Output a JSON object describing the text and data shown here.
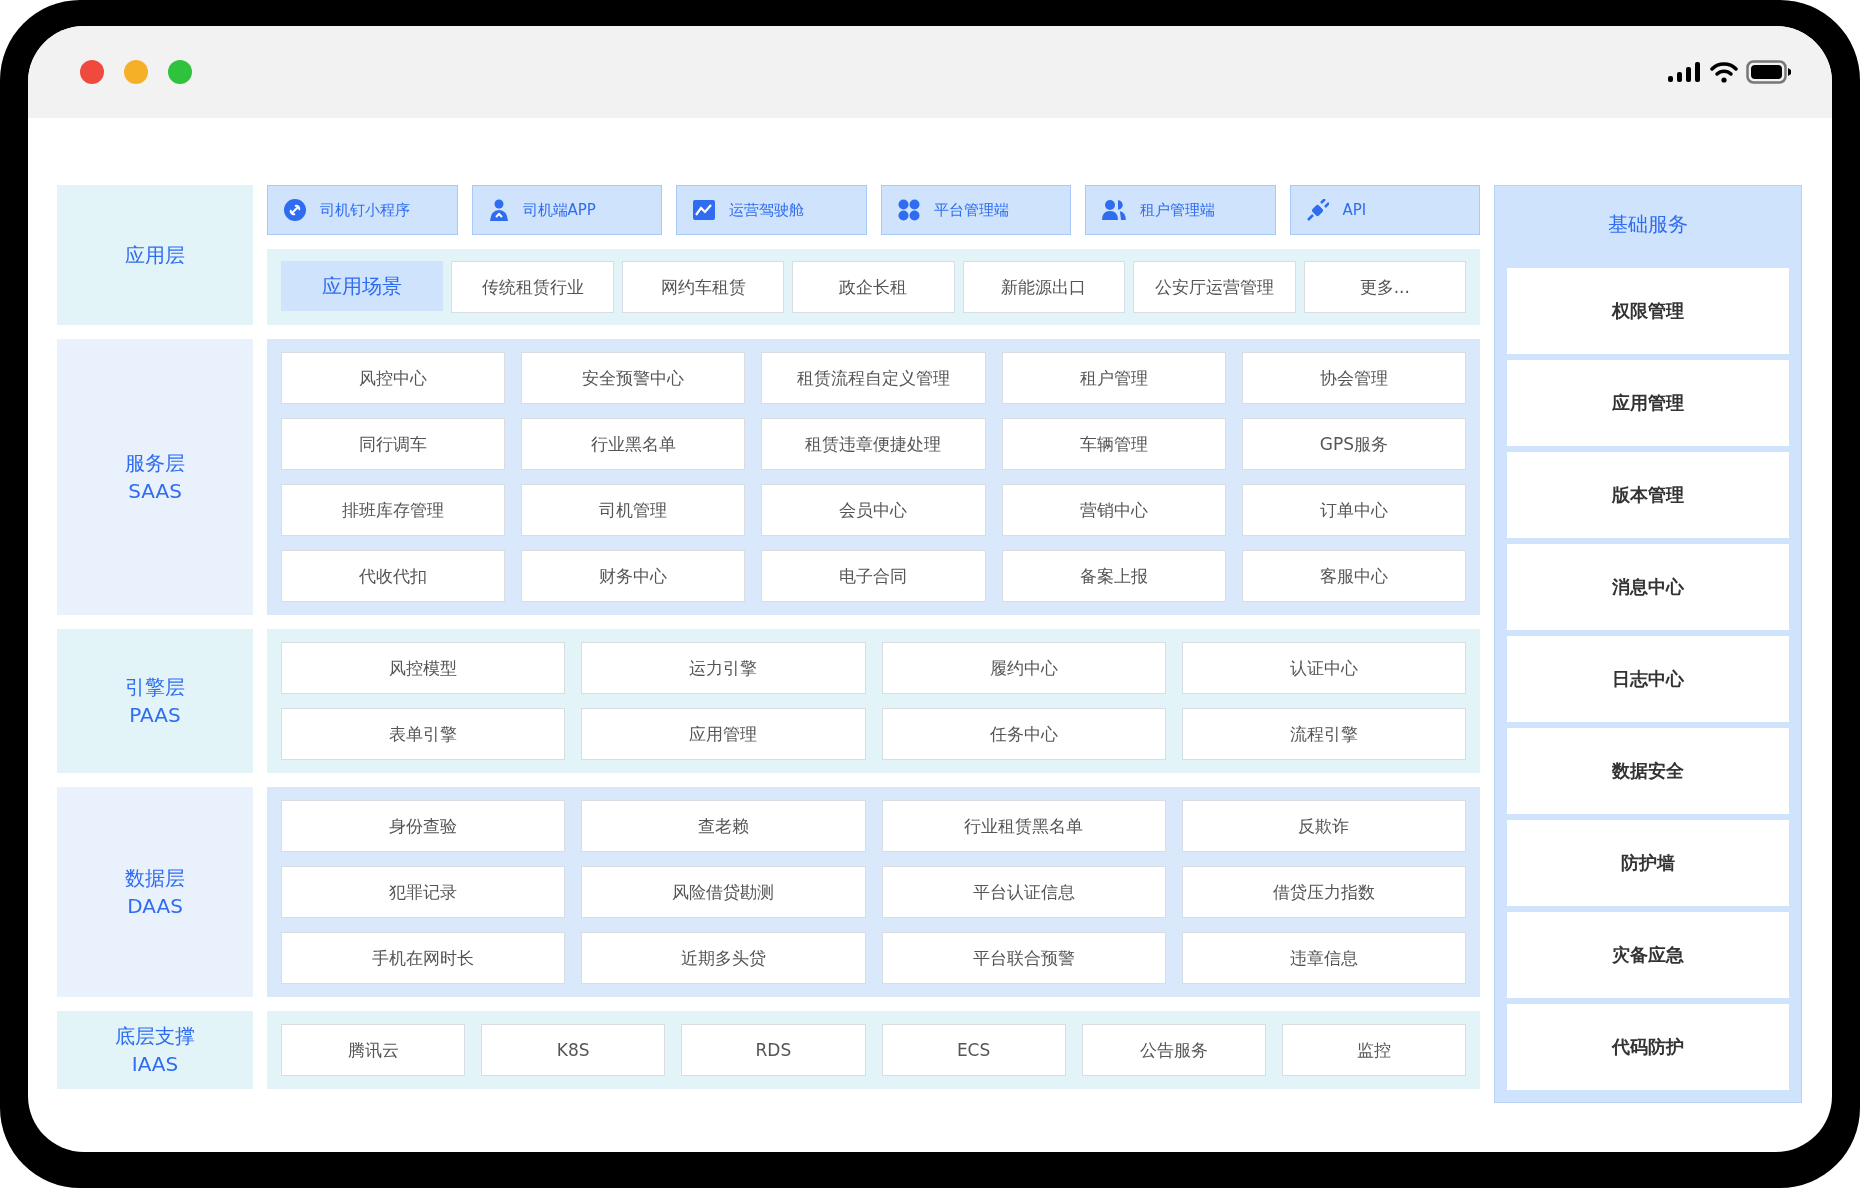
{
  "app_layer": {
    "title": "应用层",
    "entries": [
      "司机钉小程序",
      "司机端APP",
      "运营驾驶舱",
      "平台管理端",
      "租户管理端",
      "API"
    ],
    "scenario_heading": "应用场景",
    "scenarios": [
      "传统租赁行业",
      "网约车租赁",
      "政企长租",
      "新能源出口",
      "公安厅运营管理",
      "更多..."
    ]
  },
  "layers": [
    {
      "title": "服务层",
      "subtitle": "SAAS",
      "modules": [
        "风控中心",
        "安全预警中心",
        "租赁流程自定义管理",
        "租户管理",
        "协会管理",
        "同行调车",
        "行业黑名单",
        "租赁违章便捷处理",
        "车辆管理",
        "GPS服务",
        "排班库存管理",
        "司机管理",
        "会员中心",
        "营销中心",
        "订单中心",
        "代收代扣",
        "财务中心",
        "电子合同",
        "备案上报",
        "客服中心"
      ]
    },
    {
      "title": "引擎层",
      "subtitle": "PAAS",
      "modules": [
        "风控模型",
        "运力引擎",
        "履约中心",
        "认证中心",
        "表单引擎",
        "应用管理",
        "任务中心",
        "流程引擎"
      ]
    },
    {
      "title": "数据层",
      "subtitle": "DAAS",
      "modules": [
        "身份查验",
        "查老赖",
        "行业租赁黑名单",
        "反欺诈",
        "犯罪记录",
        "风险借贷勘测",
        "平台认证信息",
        "借贷压力指数",
        "手机在网时长",
        "近期多头贷",
        "平台联合预警",
        "违章信息"
      ]
    },
    {
      "title": "底层支撑",
      "subtitle": "IAAS",
      "modules": [
        "腾讯云",
        "K8S",
        "RDS",
        "ECS",
        "公告服务",
        "监控"
      ]
    }
  ],
  "basic_services": {
    "title": "基础服务",
    "items": [
      "权限管理",
      "应用管理",
      "版本管理",
      "消息中心",
      "日志中心",
      "数据安全",
      "防护墙",
      "灾备应急",
      "代码防护"
    ]
  }
}
